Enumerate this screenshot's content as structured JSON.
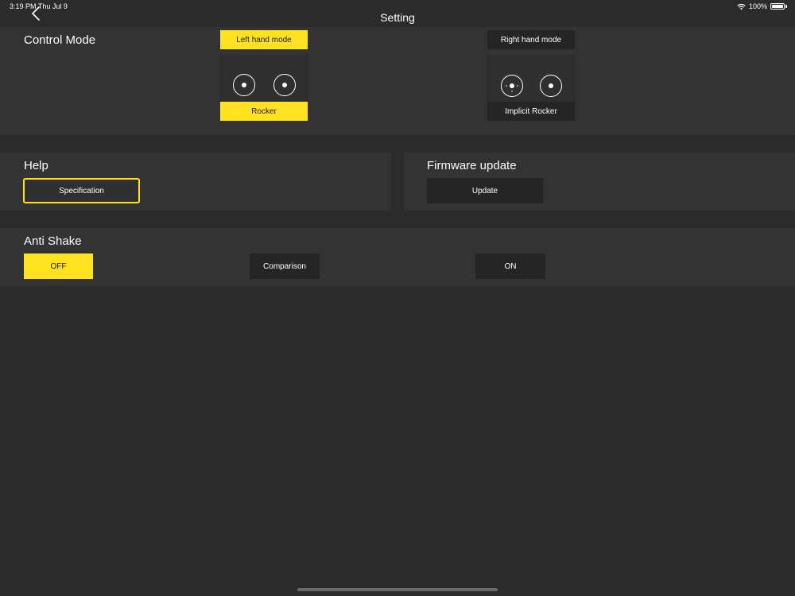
{
  "status_bar": {
    "time": "3:19 PM  Thu Jul 9",
    "battery_text": "100%",
    "wifi_icon": "wifi-icon",
    "battery_icon": "battery-icon"
  },
  "nav": {
    "title": "Setting",
    "back_icon": "chevron-left-icon"
  },
  "control_mode": {
    "title": "Control Mode",
    "left_hand_label": "Left hand mode",
    "right_hand_label": "Right hand mode",
    "rocker_label": "Rocker",
    "implicit_rocker_label": "Implicit Rocker",
    "selected": "Left hand mode"
  },
  "help": {
    "title": "Help",
    "specification_label": "Specification"
  },
  "firmware": {
    "title": "Firmware update",
    "update_label": "Update"
  },
  "anti_shake": {
    "title": "Anti Shake",
    "off_label": "OFF",
    "comparison_label": "Comparison",
    "on_label": "ON",
    "selected": "OFF"
  },
  "colors": {
    "accent": "#ffe21f",
    "background": "#2b2b2b",
    "panel": "#333333",
    "button": "#252525"
  }
}
